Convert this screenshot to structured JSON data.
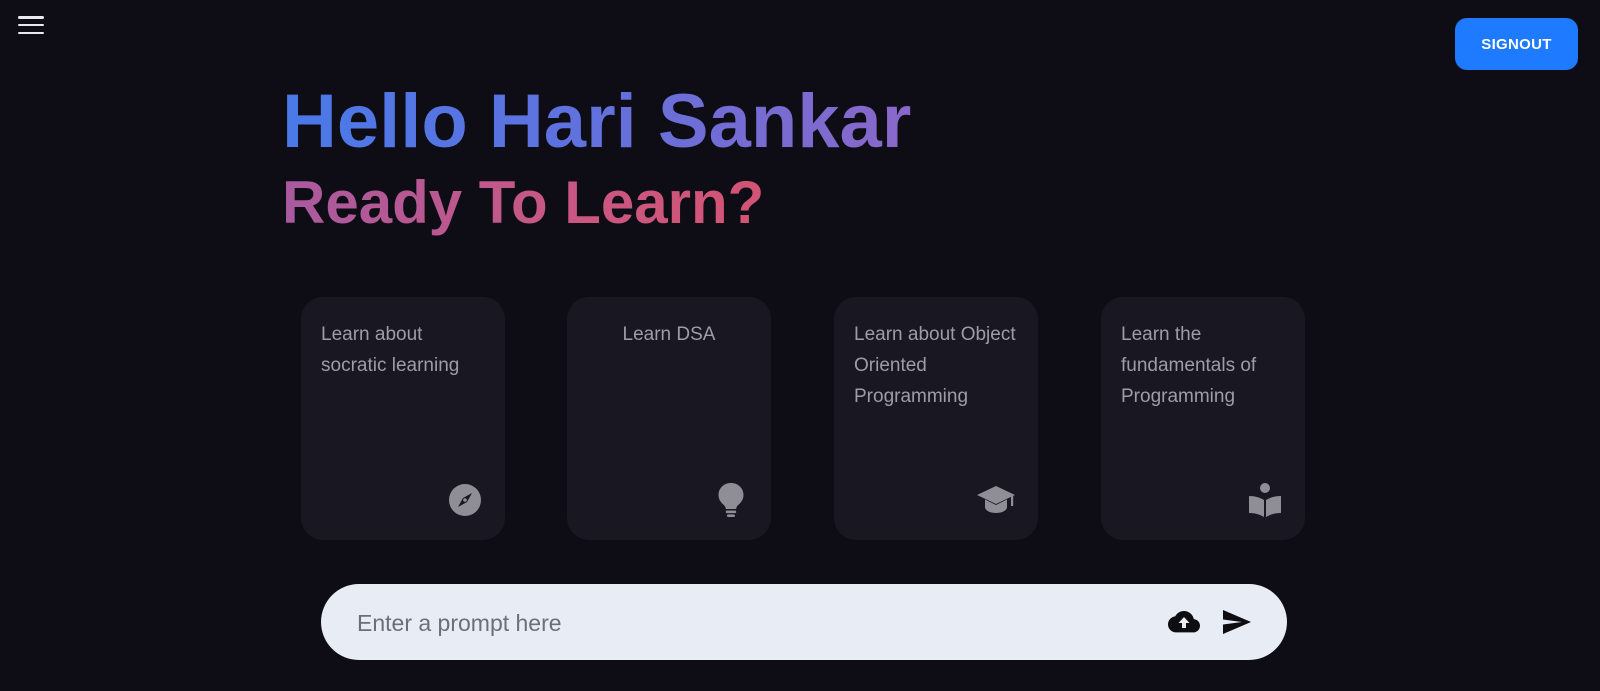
{
  "header": {
    "menu_icon": "hamburger-menu-icon",
    "signout_label": "SIGNOUT"
  },
  "greeting": {
    "hello": "Hello Hari Sankar",
    "ready": "Ready To Learn?"
  },
  "cards": [
    {
      "text": "Learn about socratic learning",
      "icon": "compass-icon"
    },
    {
      "text": "Learn DSA",
      "icon": "lightbulb-icon"
    },
    {
      "text": "Learn about Object Oriented Programming",
      "icon": "graduation-cap-icon"
    },
    {
      "text": "Learn the fundamentals of Programming",
      "icon": "reading-book-icon"
    }
  ],
  "prompt": {
    "placeholder": "Enter a prompt here",
    "value": "",
    "upload_icon": "cloud-upload-icon",
    "send_icon": "send-icon"
  },
  "colors": {
    "background": "#0e0d16",
    "accent": "#1e7bff",
    "card": "#181722",
    "prompt_bar": "#e7ecf5"
  }
}
